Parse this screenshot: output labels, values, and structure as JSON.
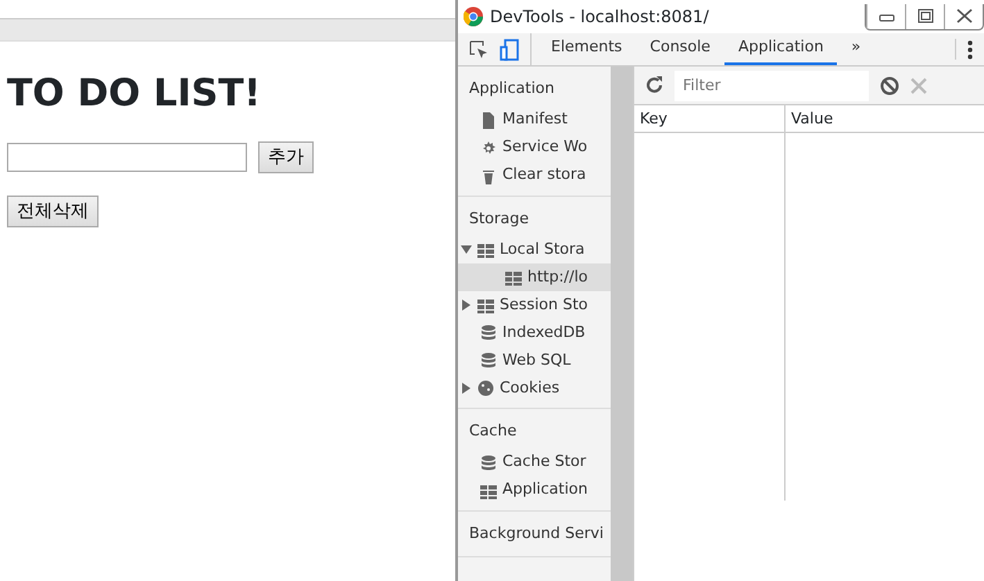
{
  "page": {
    "heading": "TO DO LIST!",
    "add_button": "추가",
    "clear_button": "전체삭제"
  },
  "devtools": {
    "title": "DevTools - localhost:8081/",
    "tabs": [
      {
        "label": "Elements",
        "selected": false
      },
      {
        "label": "Console",
        "selected": false
      },
      {
        "label": "Application",
        "selected": true
      }
    ],
    "overflow": "»",
    "sidebar": [
      {
        "title": "Application",
        "items": [
          {
            "label": "Manifest",
            "kind": "file",
            "selected": false
          },
          {
            "label": "Service Wo",
            "kind": "gear",
            "selected": false
          },
          {
            "label": "Clear stora",
            "kind": "trash",
            "selected": false
          }
        ]
      },
      {
        "title": "Storage",
        "items": [
          {
            "label": "Local Stora",
            "kind": "grid",
            "selected": false,
            "expanded": true,
            "children": [
              {
                "label": "http://lo",
                "kind": "grid",
                "selected": true
              }
            ]
          },
          {
            "label": "Session Sto",
            "kind": "grid",
            "selected": false,
            "expanded": false
          },
          {
            "label": "IndexedDB",
            "kind": "db",
            "selected": false
          },
          {
            "label": "Web SQL",
            "kind": "db",
            "selected": false
          },
          {
            "label": "Cookies",
            "kind": "cookie",
            "selected": false,
            "expanded": false
          }
        ]
      },
      {
        "title": "Cache",
        "items": [
          {
            "label": "Cache Stor",
            "kind": "db",
            "selected": false
          },
          {
            "label": "Application",
            "kind": "grid",
            "selected": false
          }
        ]
      },
      {
        "title": "Background Servi"
      }
    ],
    "filter": {
      "placeholder": "Filter"
    },
    "table": {
      "columns": [
        "Key",
        "Value"
      ]
    }
  }
}
